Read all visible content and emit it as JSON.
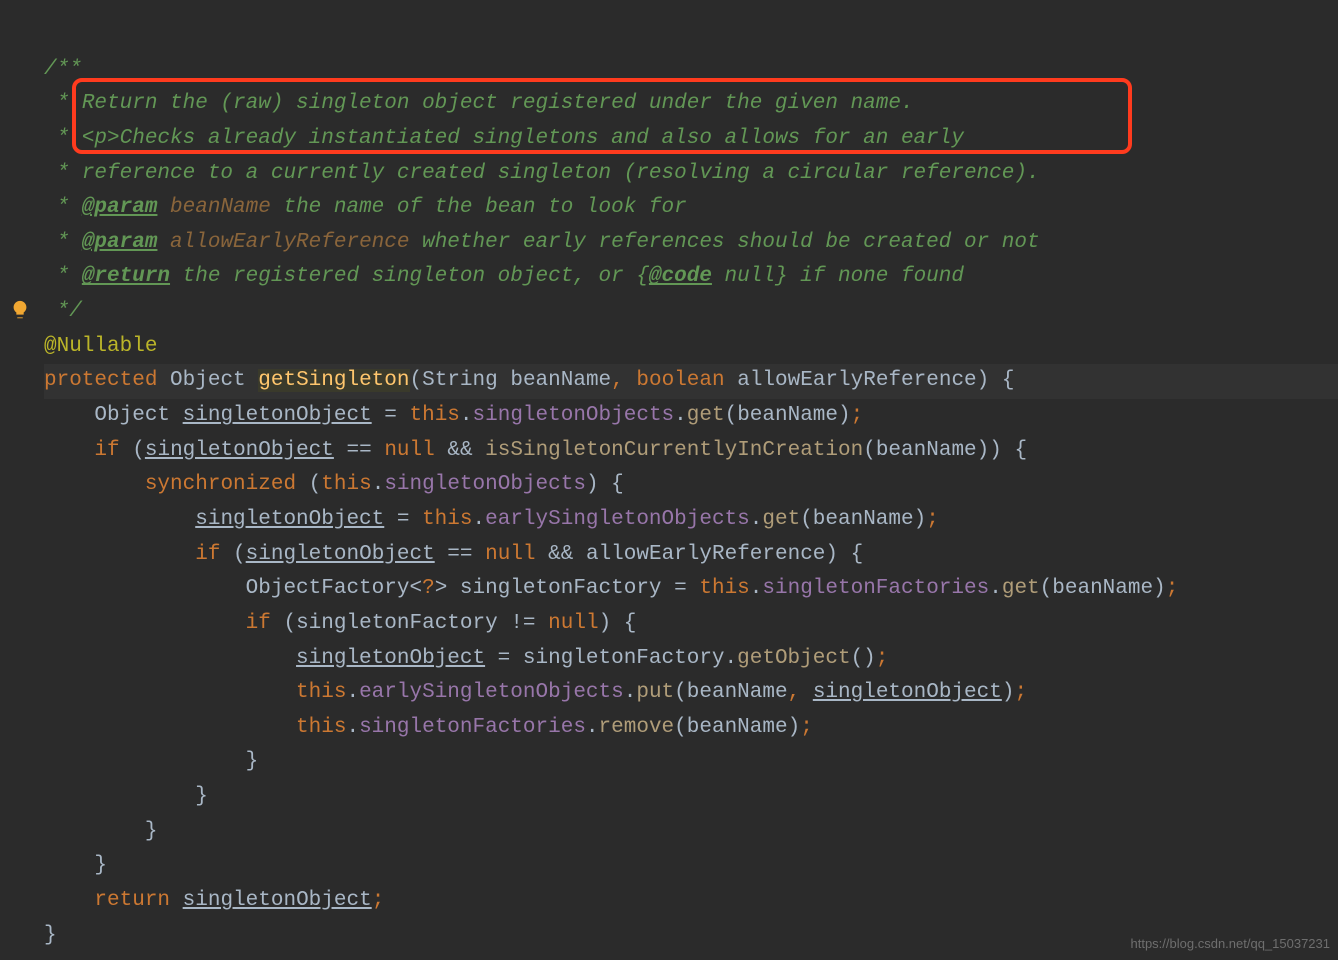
{
  "doc": {
    "open": "/**",
    "l1_pre": " * ",
    "l1": "Return the (raw) singleton object registered under the given name.",
    "l2_pre": " * ",
    "l2": "<p>Checks already instantiated singletons and also allows for an early",
    "l3_pre": " * ",
    "l3": "reference to a currently created singleton (resolving a circular reference).",
    "l4_pre": " * ",
    "tag_param": "@param",
    "p1_name": " beanName",
    "p1_desc": " the name of the bean to look for",
    "p2_name": " allowEarlyReference",
    "p2_desc": " whether early references should be created or not",
    "tag_return": "@return",
    "ret_desc_a": " the registered singleton object, or ",
    "ret_brace_l": "{",
    "tag_code": "@code",
    "ret_code_val": " null",
    "ret_brace_r": "}",
    "ret_desc_b": " if none found",
    "close": " */"
  },
  "anno": "@Nullable",
  "sig": {
    "kw_protected": "protected",
    "type_obj": "Object",
    "method": "getSingleton",
    "lp": "(",
    "p1t": "String",
    "p1n": "beanName",
    "comma": ",",
    "p2t": "boolean",
    "p2n": "allowEarlyReference",
    "rp": ")",
    "lb": "{"
  },
  "code": {
    "l1_a": "Object ",
    "l1_var": "singletonObject",
    "l1_eq": " = ",
    "l1_this": "this",
    "l1_dot": ".",
    "l1_fld": "singletonObjects",
    "l1_call": "get",
    "l1_arg": "beanName",
    "l2_if": "if",
    "l2_lp": " (",
    "l2_var": "singletonObject",
    "l2_eq": " == ",
    "l2_null": "null",
    "l2_and": " && ",
    "l2_call": "isSingletonCurrentlyInCreation",
    "l2_arg": "beanName",
    "l2_rp": ")",
    "l2_lb": " {",
    "l3_sync": "synchronized",
    "l3_lp": " (",
    "l3_this": "this",
    "l3_dot": ".",
    "l3_fld": "singletonObjects",
    "l3_rp": ")",
    "l3_lb": " {",
    "l4_var": "singletonObject",
    "l4_eq": " = ",
    "l4_this": "this",
    "l4_dot": ".",
    "l4_fld": "earlySingletonObjects",
    "l4_call": "get",
    "l4_arg": "beanName",
    "l5_if": "if",
    "l5_lp": " (",
    "l5_var": "singletonObject",
    "l5_eq": " == ",
    "l5_null": "null",
    "l5_and": " && ",
    "l5_arg": "allowEarlyReference",
    "l5_rp": ")",
    "l5_lb": " {",
    "l6_type": "ObjectFactory",
    "l6_lt": "<",
    "l6_q": "?",
    "l6_gt": ">",
    "l6_sp": " ",
    "l6_var": "singletonFactory",
    "l6_eq": " = ",
    "l6_this": "this",
    "l6_dot": ".",
    "l6_fld": "singletonFactories",
    "l6_call": "get",
    "l6_arg": "beanName",
    "l7_if": "if",
    "l7_lp": " (",
    "l7_var": "singletonFactory",
    "l7_ne": " != ",
    "l7_null": "null",
    "l7_rp": ")",
    "l7_lb": " {",
    "l8_var": "singletonObject",
    "l8_eq": " = ",
    "l8_src": "singletonFactory",
    "l8_dot": ".",
    "l8_call": "getObject",
    "l9_this": "this",
    "l9_dot": ".",
    "l9_fld": "earlySingletonObjects",
    "l9_call": "put",
    "l9_a1": "beanName",
    "l9_c": ",",
    "l9_a2": "singletonObject",
    "l10_this": "this",
    "l10_dot": ".",
    "l10_fld": "singletonFactories",
    "l10_call": "remove",
    "l10_arg": "beanName",
    "rb": "}",
    "ret": "return",
    "ret_var": "singletonObject",
    "semi": ";"
  },
  "watermark": "https://blog.csdn.net/qq_15037231"
}
